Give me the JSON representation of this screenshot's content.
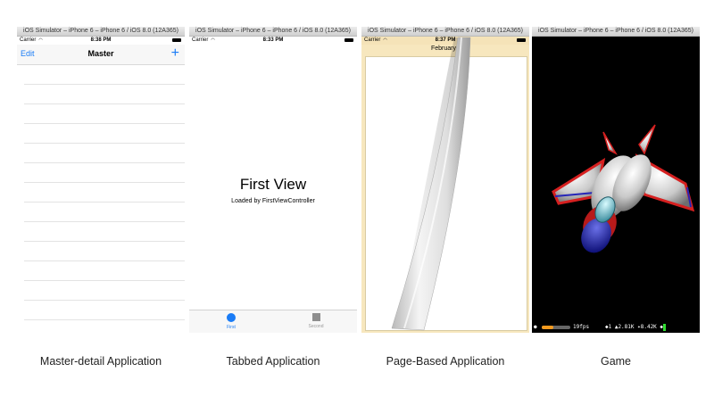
{
  "panels": [
    {
      "titlebar": "iOS Simulator – iPhone 6 – iPhone 6 / iOS 8.0 (12A365)",
      "status": {
        "carrier": "Carrier",
        "time": "8:38 PM"
      },
      "navbar": {
        "edit": "Edit",
        "title": "Master",
        "add": "+"
      },
      "caption": "Master-detail Application"
    },
    {
      "titlebar": "iOS Simulator – iPhone 6 – iPhone 6 / iOS 8.0 (12A365)",
      "status": {
        "carrier": "Carrier",
        "time": "8:33 PM"
      },
      "content": {
        "title": "First View",
        "subtitle": "Loaded by FirstViewController"
      },
      "tabs": [
        {
          "label": "First"
        },
        {
          "label": "Second"
        }
      ],
      "caption": "Tabbed Application"
    },
    {
      "titlebar": "iOS Simulator – iPhone 6 – iPhone 6 / iOS 8.0 (12A365)",
      "status": {
        "carrier": "Carrier",
        "time": "8:37 PM"
      },
      "month": "February",
      "caption": "Page-Based Application"
    },
    {
      "titlebar": "iOS Simulator – iPhone 6 – iPhone 6 / iOS 8.0 (12A365)",
      "hud": {
        "fps": "19fps",
        "stats": "◆1 ▲2.81K ✦8.42K ◆"
      },
      "caption": "Game"
    }
  ],
  "colors": {
    "ios_blue": "#1a7cf6",
    "page_bg": "#f7e7be",
    "game_bg": "#000000"
  }
}
